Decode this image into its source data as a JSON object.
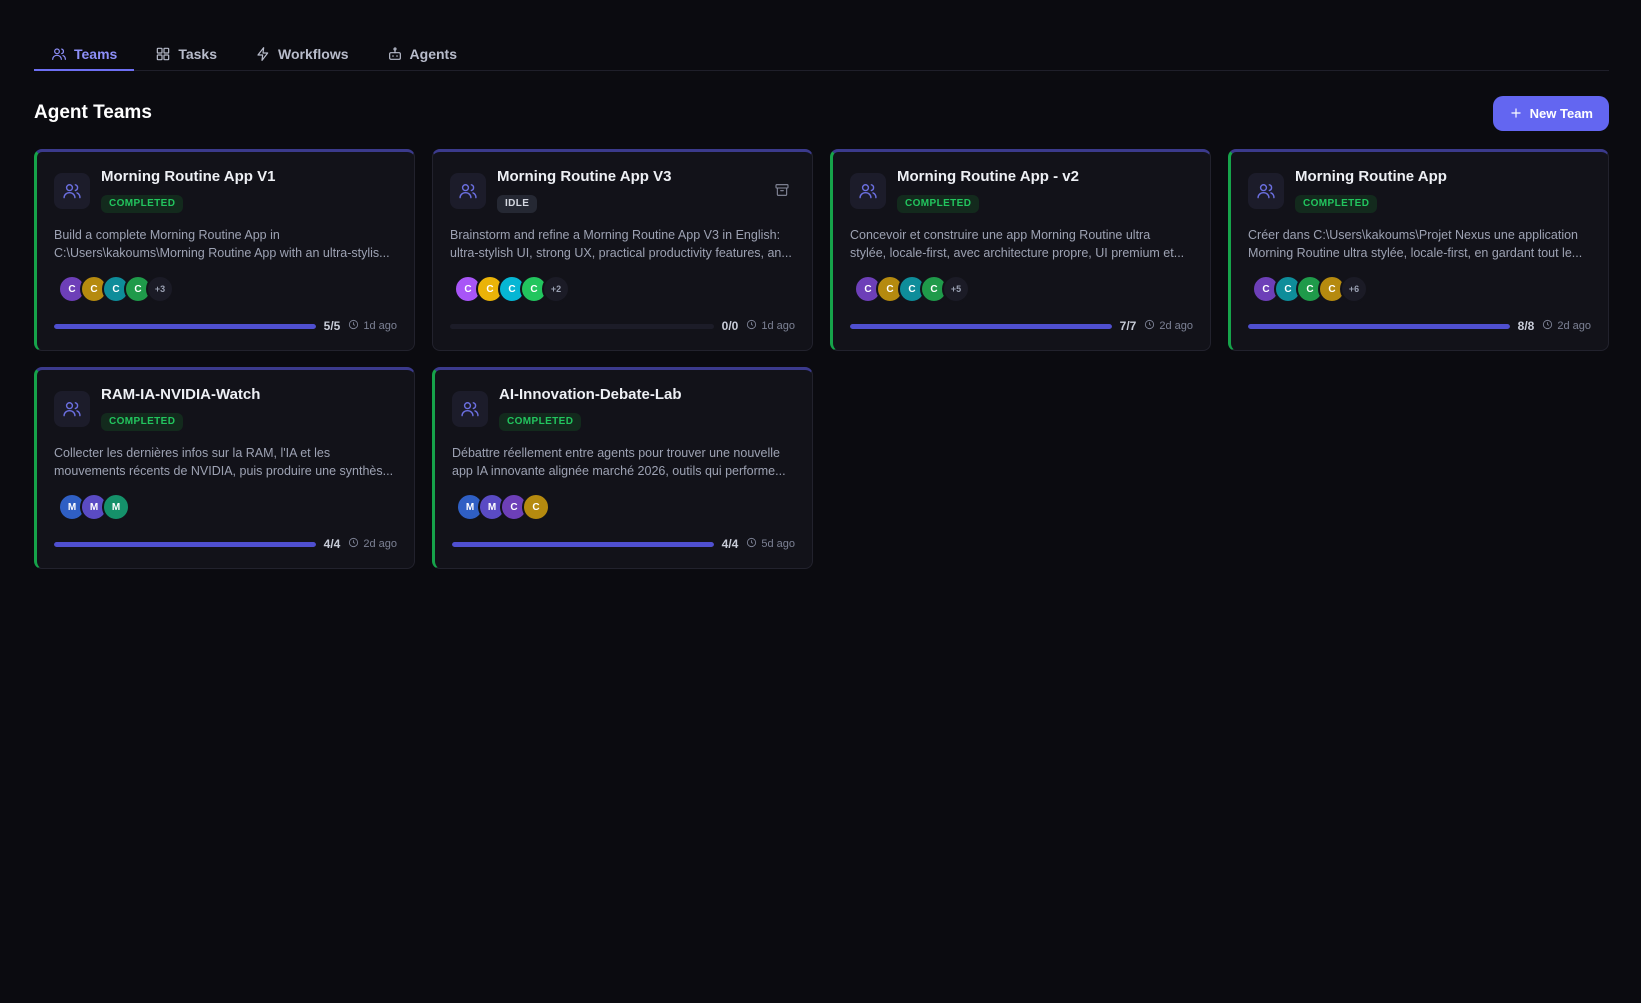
{
  "tabs": [
    {
      "label": "Teams",
      "icon": "users-icon",
      "active": true
    },
    {
      "label": "Tasks",
      "icon": "grid-icon",
      "active": false
    },
    {
      "label": "Workflows",
      "icon": "lightning-icon",
      "active": false
    },
    {
      "label": "Agents",
      "icon": "bot-icon",
      "active": false
    }
  ],
  "header": {
    "title": "Agent Teams",
    "new_team_label": "New Team"
  },
  "colors": {
    "accent": "#6366f1",
    "completed": "#22c55e",
    "progress": "#4f4fd0"
  },
  "teams": [
    {
      "title": "Morning Routine App V1",
      "status": "COMPLETED",
      "desc1": "Build a complete Morning Routine App in",
      "desc2": "C:\\Users\\kakoums\\Morning Routine App with an ultra-stylis...",
      "avatars": [
        {
          "letter": "C",
          "color": "#6d3fb8"
        },
        {
          "letter": "C",
          "color": "#b58a0f"
        },
        {
          "letter": "C",
          "color": "#0e8d9a"
        },
        {
          "letter": "C",
          "color": "#1f9a4a"
        }
      ],
      "more": "+3",
      "progress": 1.0,
      "count": "5/5",
      "ago": "1d ago"
    },
    {
      "title": "Morning Routine App V3",
      "status": "IDLE",
      "desc1": "Brainstorm and refine a Morning Routine App V3 in English:",
      "desc2": "ultra-stylish UI, strong UX, practical productivity features, an...",
      "avatars": [
        {
          "letter": "C",
          "color": "#a855f7"
        },
        {
          "letter": "C",
          "color": "#eab308"
        },
        {
          "letter": "C",
          "color": "#06b6d4"
        },
        {
          "letter": "C",
          "color": "#22c55e"
        }
      ],
      "more": "+2",
      "progress": 0,
      "count": "0/0",
      "ago": "1d ago"
    },
    {
      "title": "Morning Routine App - v2",
      "status": "COMPLETED",
      "desc1": "Concevoir et construire une app Morning Routine ultra",
      "desc2": "stylée, locale-first, avec architecture propre, UI premium et...",
      "avatars": [
        {
          "letter": "C",
          "color": "#6d3fb8"
        },
        {
          "letter": "C",
          "color": "#b58a0f"
        },
        {
          "letter": "C",
          "color": "#0e8d9a"
        },
        {
          "letter": "C",
          "color": "#1f9a4a"
        }
      ],
      "more": "+5",
      "progress": 1.0,
      "count": "7/7",
      "ago": "2d ago"
    },
    {
      "title": "Morning Routine App",
      "status": "COMPLETED",
      "desc1": "Créer dans C:\\Users\\kakoums\\Projet Nexus une application",
      "desc2": "Morning Routine ultra stylée, locale-first, en gardant tout le...",
      "avatars": [
        {
          "letter": "C",
          "color": "#6d3fb8"
        },
        {
          "letter": "C",
          "color": "#0e8d9a"
        },
        {
          "letter": "C",
          "color": "#1f9a4a"
        },
        {
          "letter": "C",
          "color": "#b58a0f"
        }
      ],
      "more": "+6",
      "progress": 1.0,
      "count": "8/8",
      "ago": "2d ago"
    },
    {
      "title": "RAM-IA-NVIDIA-Watch",
      "status": "COMPLETED",
      "desc1": "Collecter les dernières infos sur la RAM, l'IA et les",
      "desc2": "mouvements récents de NVIDIA, puis produire une synthès...",
      "avatars": [
        {
          "letter": "M",
          "color": "#2f5fc4"
        },
        {
          "letter": "M",
          "color": "#5a4bc4"
        },
        {
          "letter": "M",
          "color": "#15916a"
        }
      ],
      "more": "",
      "progress": 1.0,
      "count": "4/4",
      "ago": "2d ago"
    },
    {
      "title": "AI-Innovation-Debate-Lab",
      "status": "COMPLETED",
      "desc1": "Débattre réellement entre agents pour trouver une nouvelle",
      "desc2": "app IA innovante alignée marché 2026, outils qui performe...",
      "avatars": [
        {
          "letter": "M",
          "color": "#2f5fc4"
        },
        {
          "letter": "M",
          "color": "#5a4bc4"
        },
        {
          "letter": "C",
          "color": "#6d3fb8"
        },
        {
          "letter": "C",
          "color": "#b58a0f"
        }
      ],
      "more": "",
      "progress": 1.0,
      "count": "4/4",
      "ago": "5d ago"
    }
  ]
}
